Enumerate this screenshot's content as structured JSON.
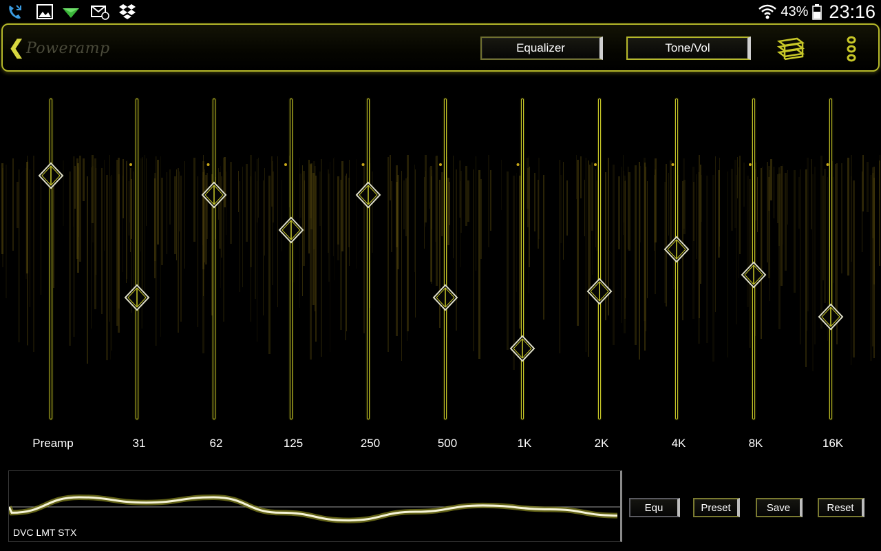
{
  "status_bar": {
    "icons": [
      "missed-call-icon",
      "gallery-icon",
      "download-icon",
      "email-icon",
      "dropbox-icon"
    ],
    "battery_percent": "43%",
    "time": "23:16"
  },
  "toolbar": {
    "logo_text": "Poweramp",
    "equalizer_label": "Equalizer",
    "tone_vol_label": "Tone/Vol"
  },
  "eq": {
    "bands": [
      {
        "label": "Preamp",
        "level": 0.76
      },
      {
        "label": "31",
        "level": 0.38
      },
      {
        "label": "62",
        "level": 0.7
      },
      {
        "label": "125",
        "level": 0.59
      },
      {
        "label": "250",
        "level": 0.7
      },
      {
        "label": "500",
        "level": 0.38
      },
      {
        "label": "1K",
        "level": 0.22
      },
      {
        "label": "2K",
        "level": 0.4
      },
      {
        "label": "4K",
        "level": 0.53
      },
      {
        "label": "8K",
        "level": 0.45
      },
      {
        "label": "16K",
        "level": 0.32
      }
    ]
  },
  "bottom": {
    "curve_caption": "DVC LMT STX",
    "equ_label": "Equ",
    "preset_label": "Preset",
    "save_label": "Save",
    "reset_label": "Reset"
  },
  "colors": {
    "accent": "#c8c828",
    "background": "#000000",
    "text": "#ffffff"
  }
}
